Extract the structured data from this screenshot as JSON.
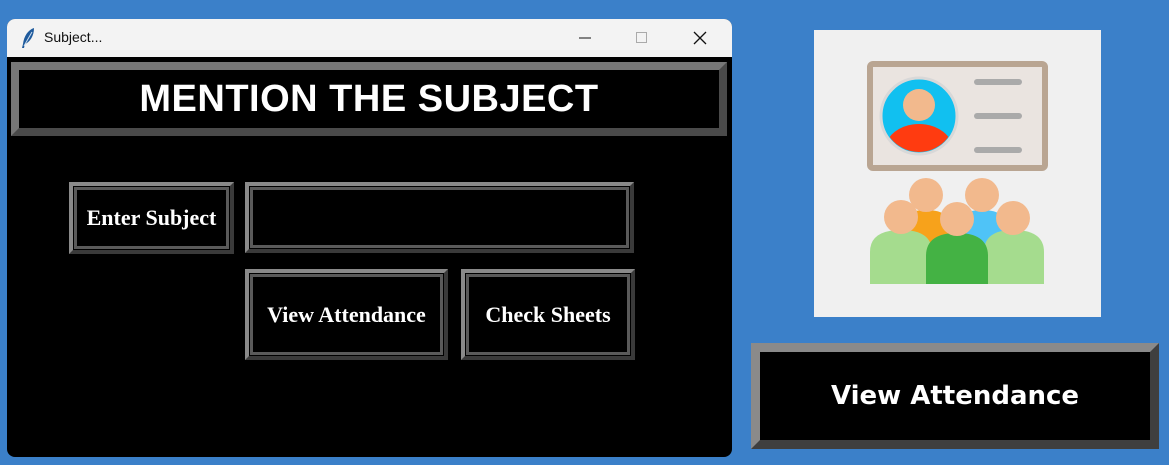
{
  "window": {
    "title": "Subject...",
    "controls": [
      "minimize",
      "maximize",
      "close"
    ]
  },
  "heading": "MENTION THE SUBJECT",
  "form": {
    "enter_subject_label": "Enter Subject",
    "subject_value": "",
    "view_attendance_label": "View Attendance",
    "check_sheets_label": "Check Sheets"
  },
  "side": {
    "illustration_icon": "id-card-and-group-of-people-icon",
    "view_attendance_label": "View Attendance"
  },
  "colors": {
    "desktop": "#3b80c9",
    "window_bg": "#000000",
    "text": "#ffffff"
  }
}
